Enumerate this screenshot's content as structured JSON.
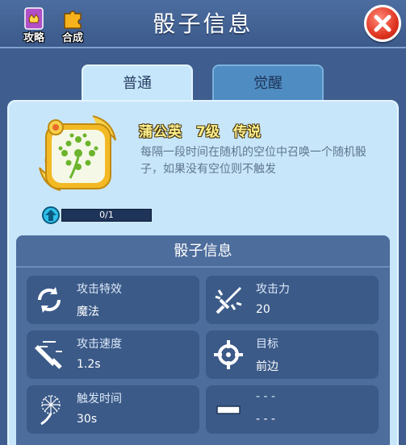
{
  "header": {
    "title": "骰子信息"
  },
  "toolbar": {
    "guide_label": "攻略",
    "merge_label": "合成"
  },
  "tabs": [
    {
      "label": "普通"
    },
    {
      "label": "觉醒"
    }
  ],
  "dice": {
    "name": "蒲公英",
    "level": "7级",
    "rarity": "传说",
    "description": "每隔一段时间在随机的空位中召唤一个随机骰子，如果没有空位则不触发",
    "progress_text": "0/1",
    "progress_fraction": 0
  },
  "info": {
    "header": "骰子信息",
    "stats": [
      {
        "label": "攻击特效",
        "value": "魔法"
      },
      {
        "label": "攻击力",
        "value": "20"
      },
      {
        "label": "攻击速度",
        "value": "1.2s"
      },
      {
        "label": "目标",
        "value": "前边"
      },
      {
        "label": "触发时间",
        "value": "30s"
      },
      {
        "label": "- - -",
        "value": "- - -"
      }
    ]
  },
  "colors": {
    "accent": "#c5e6fb",
    "header_bg": "#3f5e8f",
    "gold_text": "#ffef8a"
  }
}
